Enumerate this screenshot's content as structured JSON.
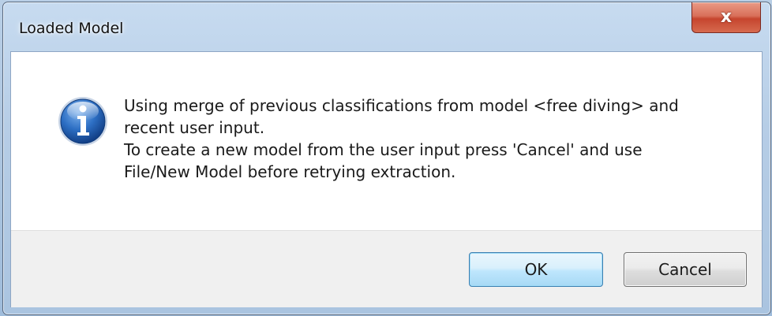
{
  "window": {
    "title": "Loaded Model",
    "close_glyph": "x"
  },
  "dialog": {
    "icon": "info-icon",
    "message_lines": [
      "Using merge of previous classifications from model <free diving> and",
      "recent user input.",
      "To create a new model from the user input press 'Cancel' and use",
      "File/New Model before retrying extraction."
    ]
  },
  "buttons": {
    "ok_label": "OK",
    "cancel_label": "Cancel"
  },
  "colors": {
    "accent": "#3c7fb1",
    "close": "#c6452e",
    "info_icon": "#1f5aa8"
  }
}
